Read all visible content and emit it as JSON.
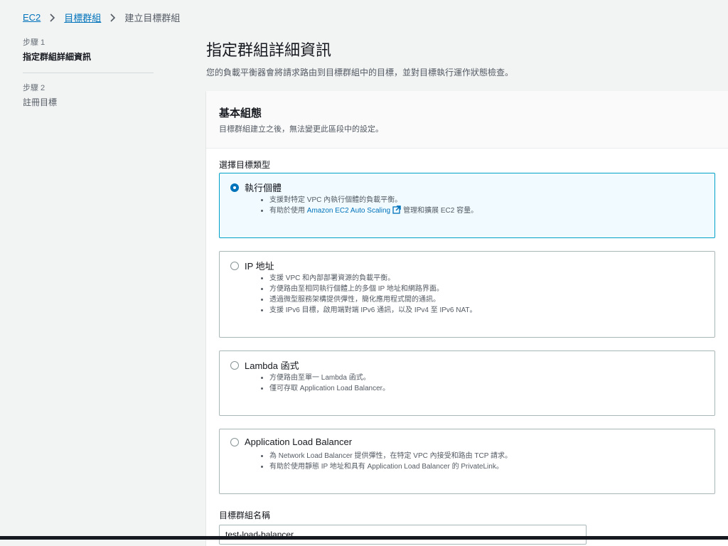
{
  "breadcrumb": {
    "items": [
      {
        "label": "EC2"
      },
      {
        "label": "目標群組"
      }
    ],
    "current": "建立目標群組"
  },
  "steps": [
    {
      "number": "步驟 1",
      "title": "指定群組詳細資訊"
    },
    {
      "number": "步驟 2",
      "title": "註冊目標"
    }
  ],
  "page": {
    "title": "指定群組詳細資訊",
    "description": "您的負載平衡器會將請求路由到目標群組中的目標，並對目標執行運作狀態檢查。"
  },
  "basic_config": {
    "title": "基本組態",
    "description": "目標群組建立之後，無法變更此區段中的設定。",
    "target_type_label": "選擇目標類型",
    "options": [
      {
        "label": "執行個體",
        "selected": true,
        "bullets": [
          "支援對特定 VPC 內執行個體的負載平衡。"
        ],
        "bullet2_prefix": "有助於使用",
        "bullet2_link": "Amazon EC2 Auto Scaling",
        "bullet2_suffix": "管理和擴展 EC2 容量。"
      },
      {
        "label": "IP 地址",
        "selected": false,
        "bullets": [
          "支援 VPC 和內部部署資源的負載平衡。",
          "方便路由至相同執行個體上的多個 IP 地址和網路界面。",
          "透過微型服務架構提供彈性，簡化應用程式間的通訊。",
          "支援 IPv6 目標，啟用端對端 IPv6 通訊，以及 IPv4 至 IPv6 NAT。"
        ]
      },
      {
        "label": "Lambda 函式",
        "selected": false,
        "bullets": [
          "方便路由至單一 Lambda 函式。",
          "僅可存取 Application Load Balancer。"
        ]
      },
      {
        "label": "Application Load Balancer",
        "selected": false,
        "bullets": [
          "為 Network Load Balancer 提供彈性，在特定 VPC 內接受和路由 TCP 請求。",
          "有助於使用靜態 IP 地址和具有 Application Load Balancer 的 PrivateLink。"
        ]
      }
    ],
    "name_label": "目標群組名稱",
    "name_value": "test-load-balancer"
  }
}
